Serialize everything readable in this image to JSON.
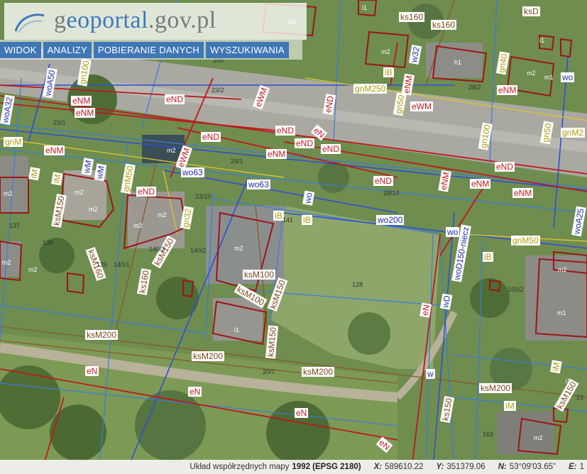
{
  "header": {
    "logo_prefix": "g",
    "logo_highlight": "eoportal",
    "logo_suffix": ".gov.pl"
  },
  "menu": {
    "items": [
      "WIDOK",
      "ANALIZY",
      "POBIERANIE DANYCH",
      "WYSZUKIWANIA"
    ]
  },
  "status": {
    "label": "Układ współrzędnych mapy",
    "crs": "1992 (EPSG 2180)",
    "x_label": "X:",
    "x_value": "589610.22",
    "y_label": "Y:",
    "y_value": "351379.06",
    "n_label": "N:",
    "n_value": "53°09'03.65\"",
    "e_label": "E:",
    "e_value": "1"
  },
  "map": {
    "colors": {
      "sewer": "#c0181d",
      "water": "#2f4fd6",
      "gas": "#d8c233",
      "telecom": "#8a5a2b",
      "parcel": "#3c7be0"
    },
    "red_labels": [
      "eNM",
      "eNM",
      "eND",
      "eWM",
      "eND",
      "eND",
      "eNM",
      "eND",
      "eNM",
      "eND",
      "eND",
      "eWM",
      "eNM",
      "eND",
      "eNM",
      "eWM",
      "eNM",
      "eND",
      "eN",
      "eNM",
      "eNM",
      "eN",
      "eN",
      "eN",
      "eN",
      "eND",
      "eN"
    ],
    "yellow_labels": [
      "gn100",
      "gn40",
      "gnM250",
      "gn50",
      "gn50",
      "gnM",
      "gnM50",
      "gn32",
      "gnM50",
      "gn100",
      "gnM2",
      "iM",
      "iM",
      "iB",
      "iB",
      "iM",
      "iB",
      "iM",
      "iB"
    ],
    "blue_labels": [
      "woA50",
      "woA32",
      "wo63",
      "wo63",
      "wo",
      "wo200",
      "wo",
      "woD150-niecz",
      "wD",
      "woA25",
      "w32",
      "wo",
      "wM",
      "w",
      "wM"
    ],
    "brown_labels": [
      "ks160",
      "ks160",
      "ksD",
      "ksM150",
      "ksM160",
      "ks160",
      "ksM150",
      "ksM100",
      "ksM100",
      "ksM150",
      "ksM150",
      "ksM200",
      "ksM200",
      "ksM200",
      "ks150",
      "ksM200",
      "ksM150"
    ],
    "building_labels": [
      "m2",
      "m2",
      "m2",
      "m2",
      "m2",
      "m2",
      "m2",
      "m2",
      "m2",
      "m1",
      "m2",
      "i1",
      "m2",
      "m2",
      "m1",
      "m2",
      "h1",
      "m2",
      "i1",
      "i1",
      "i1"
    ],
    "parcel_numbers": [
      "23/1",
      "23/2",
      "24/1",
      "23/10",
      "28/10",
      "141",
      "137",
      "138",
      "140/1",
      "140/3",
      "140/2",
      "139",
      "128",
      "155/2",
      "20/7",
      "163",
      "13",
      "28/2",
      "200"
    ]
  }
}
